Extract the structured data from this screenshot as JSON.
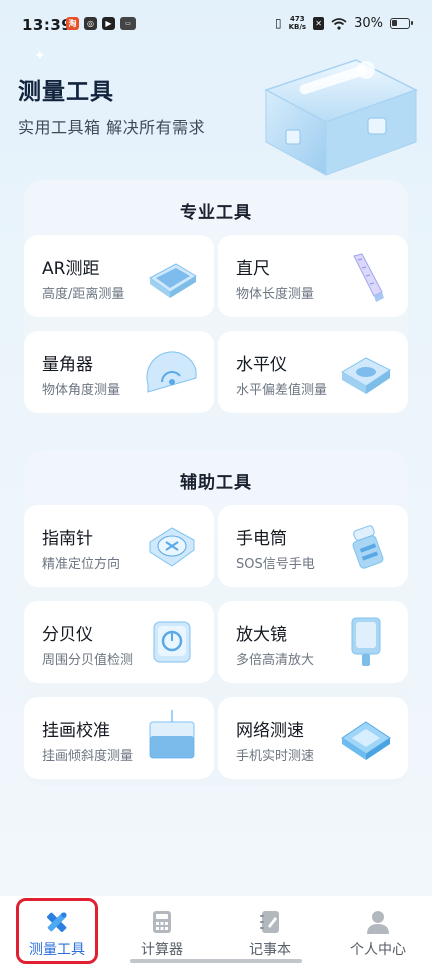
{
  "status_bar": {
    "time": "13:39",
    "network_speed_value": "473",
    "network_speed_unit": "KB/s",
    "battery": "30%"
  },
  "header": {
    "title": "测量工具",
    "subtitle": "实用工具箱 解决所有需求"
  },
  "professional": {
    "title": "专业工具",
    "tools": [
      {
        "title": "AR测距",
        "desc": "高度/距离测量",
        "icon": "ar-device-icon"
      },
      {
        "title": "直尺",
        "desc": "物体长度测量",
        "icon": "ruler-icon"
      },
      {
        "title": "量角器",
        "desc": "物体角度测量",
        "icon": "protractor-icon"
      },
      {
        "title": "水平仪",
        "desc": "水平偏差值测量",
        "icon": "level-icon"
      }
    ]
  },
  "auxiliary": {
    "title": "辅助工具",
    "tools": [
      {
        "title": "指南针",
        "desc": "精准定位方向",
        "icon": "compass-icon"
      },
      {
        "title": "手电筒",
        "desc": "SOS信号手电",
        "icon": "flashlight-icon"
      },
      {
        "title": "分贝仪",
        "desc": "周围分贝值检测",
        "icon": "decibel-meter-icon"
      },
      {
        "title": "放大镜",
        "desc": "多倍高清放大",
        "icon": "magnifier-icon"
      },
      {
        "title": "挂画校准",
        "desc": "挂画倾斜度测量",
        "icon": "picture-level-icon"
      },
      {
        "title": "网络测速",
        "desc": "手机实时测速",
        "icon": "network-speed-icon"
      }
    ]
  },
  "tabbar": {
    "tabs": [
      {
        "label": "测量工具",
        "icon": "ruler-pencil-icon",
        "active": true
      },
      {
        "label": "计算器",
        "icon": "calculator-icon",
        "active": false
      },
      {
        "label": "记事本",
        "icon": "notebook-icon",
        "active": false
      },
      {
        "label": "个人中心",
        "icon": "person-icon",
        "active": false
      }
    ]
  },
  "colors": {
    "accent": "#2a6fdb",
    "highlight_outline": "#e02030",
    "icon_glass": "#7fc2f0"
  }
}
